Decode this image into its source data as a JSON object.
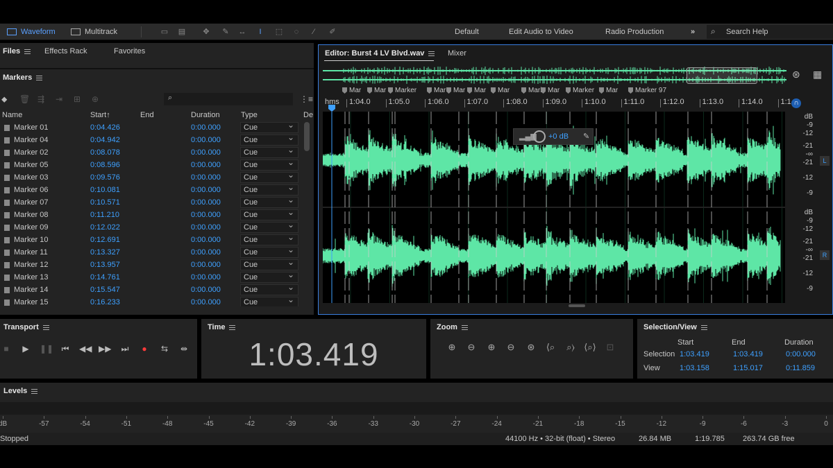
{
  "toolbar": {
    "waveform_label": "Waveform",
    "multitrack_label": "Multitrack",
    "workspaces": [
      "Default",
      "Edit Audio to Video",
      "Radio Production"
    ],
    "more": "»",
    "search_placeholder": "Search Help"
  },
  "files_panel": {
    "tabs": [
      "Files",
      "Effects Rack",
      "Favorites"
    ]
  },
  "markers_panel": {
    "title": "Markers",
    "columns": [
      "Name",
      "Start",
      "End",
      "Duration",
      "Type",
      "De"
    ],
    "sort_indicator": "↑",
    "rows": [
      {
        "name": "Marker 01",
        "start": "0:04.426",
        "duration": "0:00.000",
        "type": "Cue"
      },
      {
        "name": "Marker 04",
        "start": "0:04.942",
        "duration": "0:00.000",
        "type": "Cue"
      },
      {
        "name": "Marker 02",
        "start": "0:08.078",
        "duration": "0:00.000",
        "type": "Cue"
      },
      {
        "name": "Marker 05",
        "start": "0:08.596",
        "duration": "0:00.000",
        "type": "Cue"
      },
      {
        "name": "Marker 03",
        "start": "0:09.576",
        "duration": "0:00.000",
        "type": "Cue"
      },
      {
        "name": "Marker 06",
        "start": "0:10.081",
        "duration": "0:00.000",
        "type": "Cue"
      },
      {
        "name": "Marker 07",
        "start": "0:10.571",
        "duration": "0:00.000",
        "type": "Cue"
      },
      {
        "name": "Marker 08",
        "start": "0:11.210",
        "duration": "0:00.000",
        "type": "Cue"
      },
      {
        "name": "Marker 09",
        "start": "0:12.022",
        "duration": "0:00.000",
        "type": "Cue"
      },
      {
        "name": "Marker 10",
        "start": "0:12.691",
        "duration": "0:00.000",
        "type": "Cue"
      },
      {
        "name": "Marker 11",
        "start": "0:13.327",
        "duration": "0:00.000",
        "type": "Cue"
      },
      {
        "name": "Marker 12",
        "start": "0:13.957",
        "duration": "0:00.000",
        "type": "Cue"
      },
      {
        "name": "Marker 13",
        "start": "0:14.761",
        "duration": "0:00.000",
        "type": "Cue"
      },
      {
        "name": "Marker 14",
        "start": "0:15.547",
        "duration": "0:00.000",
        "type": "Cue"
      },
      {
        "name": "Marker 15",
        "start": "0:16.233",
        "duration": "0:00.000",
        "type": "Cue"
      }
    ]
  },
  "editor": {
    "tab_label": "Editor: Burst 4 LV Blvd.wav",
    "mixer_label": "Mixer",
    "ruler_unit": "hms",
    "ruler_ticks": [
      "1:04.0",
      "1:05.0",
      "1:06.0",
      "1:07.0",
      "1:08.0",
      "1:09.0",
      "1:10.0",
      "1:11.0",
      "1:12.0",
      "1:13.0",
      "1:14.0",
      "1:1"
    ],
    "marker_tags": [
      "Mar",
      "Mar",
      "Marker",
      "Mar",
      "Mar",
      "Mar",
      "Mar",
      "Mark",
      "Mar",
      "Marker",
      "Mar",
      "Marker 97"
    ],
    "hud_gain": "+0 dB",
    "db_scale_top": [
      "dB",
      "-9",
      "-12",
      "-21",
      "-∞",
      "-21",
      "-12",
      "-9"
    ],
    "db_scale_bottom": [
      "dB",
      "-9",
      "-12",
      "-21",
      "-∞",
      "-21",
      "-12",
      "-9"
    ],
    "channel_left": "L",
    "channel_right": "R",
    "waveform_color": "#5ee6a6"
  },
  "transport": {
    "title": "Transport"
  },
  "time_panel": {
    "title": "Time",
    "value": "1:03.419"
  },
  "zoom_panel": {
    "title": "Zoom"
  },
  "selection_view": {
    "title": "Selection/View",
    "headers": [
      "Start",
      "End",
      "Duration"
    ],
    "selection_label": "Selection",
    "view_label": "View",
    "selection": {
      "start": "1:03.419",
      "end": "1:03.419",
      "duration": "0:00.000"
    },
    "view": {
      "start": "1:03.158",
      "end": "1:15.017",
      "duration": "0:11.859"
    }
  },
  "levels": {
    "title": "Levels",
    "scale": [
      "dB",
      "-57",
      "-54",
      "-51",
      "-48",
      "-45",
      "-42",
      "-39",
      "-36",
      "-33",
      "-30",
      "-27",
      "-24",
      "-21",
      "-18",
      "-15",
      "-12",
      "-9",
      "-6",
      "-3",
      "0"
    ]
  },
  "status_bar": {
    "state": "Stopped",
    "format": "44100 Hz • 32-bit (float) • Stereo",
    "size": "26.84 MB",
    "duration": "1:19.785",
    "free": "263.74 GB free"
  }
}
